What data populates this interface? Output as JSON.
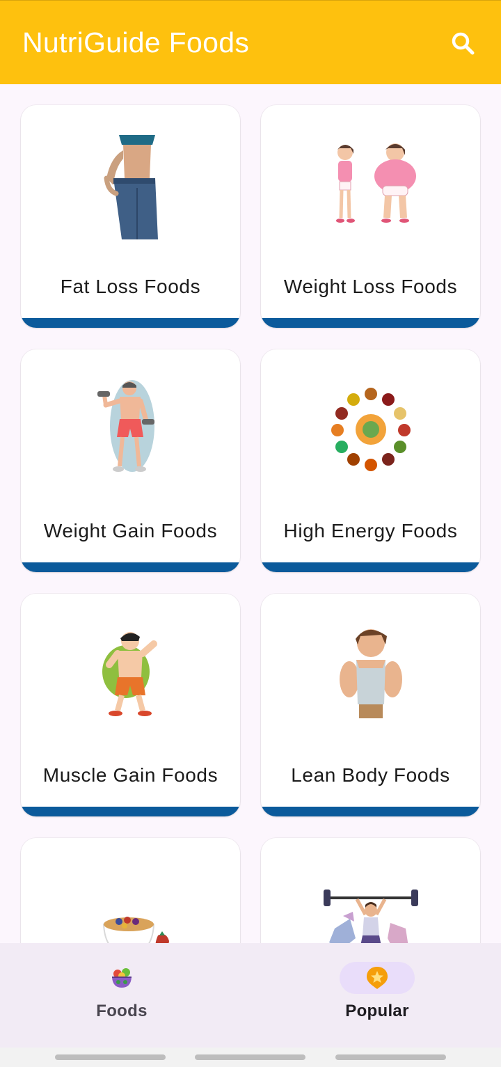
{
  "app_bar": {
    "title": "NutriGuide Foods",
    "icon": "search-icon"
  },
  "categories": [
    {
      "label": "Fat Loss Foods",
      "image": "waist-jeans-illustration"
    },
    {
      "label": "Weight Loss Foods",
      "image": "slim-and-overweight-girls-illustration"
    },
    {
      "label": "Weight Gain Foods",
      "image": "man-with-dumbbells-illustration"
    },
    {
      "label": "High Energy Foods",
      "image": "food-bowls-circle-illustration"
    },
    {
      "label": "Muscle Gain Foods",
      "image": "flexing-cartoon-man-illustration"
    },
    {
      "label": "Lean Body Foods",
      "image": "muscular-cartoon-man-illustration"
    },
    {
      "label": "",
      "image": "granola-bowl-with-berries-illustration"
    },
    {
      "label": "",
      "image": "woman-lifting-barbell-illustration"
    }
  ],
  "bottom_nav": {
    "items": [
      {
        "label": "Foods",
        "icon": "salad-bowl-icon",
        "active": false
      },
      {
        "label": "Popular",
        "icon": "star-badge-icon",
        "active": true
      }
    ]
  },
  "colors": {
    "app_bar": "#fec10e",
    "card_accent": "#0b5a9b",
    "background": "#fcf6fd",
    "nav_background": "#f2ebf5",
    "nav_active_pill": "#e9ddfa"
  }
}
